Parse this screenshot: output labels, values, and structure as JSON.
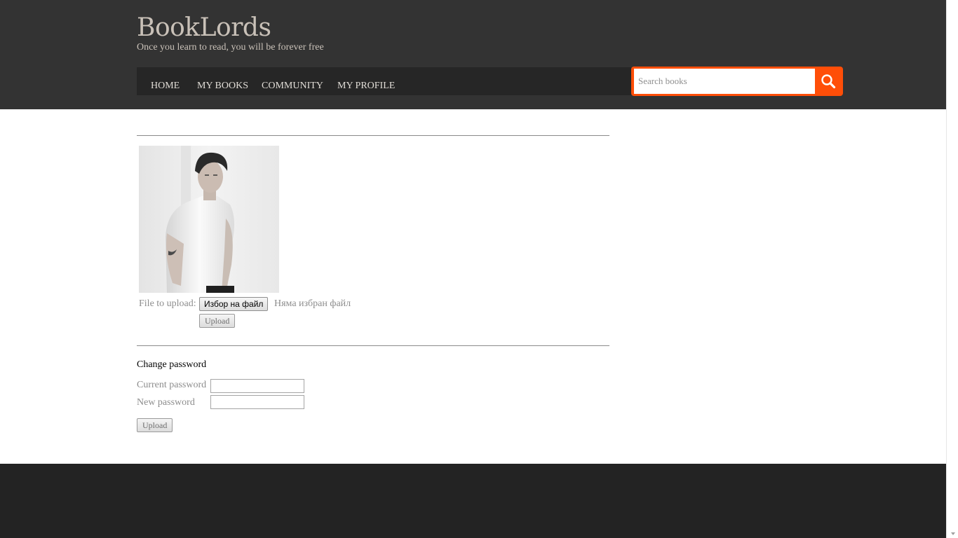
{
  "header": {
    "site_title": "BookLords",
    "tagline": "Once you learn to read, you will be forever free",
    "nav": [
      {
        "label": "HOME"
      },
      {
        "label": "MY BOOKS"
      },
      {
        "label": "COMMUNITY"
      },
      {
        "label": "MY PROFILE"
      }
    ],
    "search": {
      "placeholder": "Search books",
      "icon": "search-icon"
    }
  },
  "profile_photo": {
    "upload_label": "File to upload:",
    "choose_file_button": "Избор на файл",
    "no_file_text": "Няма избран файл",
    "upload_button": "Upload"
  },
  "password_form": {
    "title": "Change password",
    "current_label": "Current password",
    "new_label": "New password",
    "submit_button": "Upload"
  },
  "colors": {
    "header_bg": "#333333",
    "nav_bg": "#262626",
    "accent": "#ff4e08",
    "footer_bg": "#232323"
  }
}
